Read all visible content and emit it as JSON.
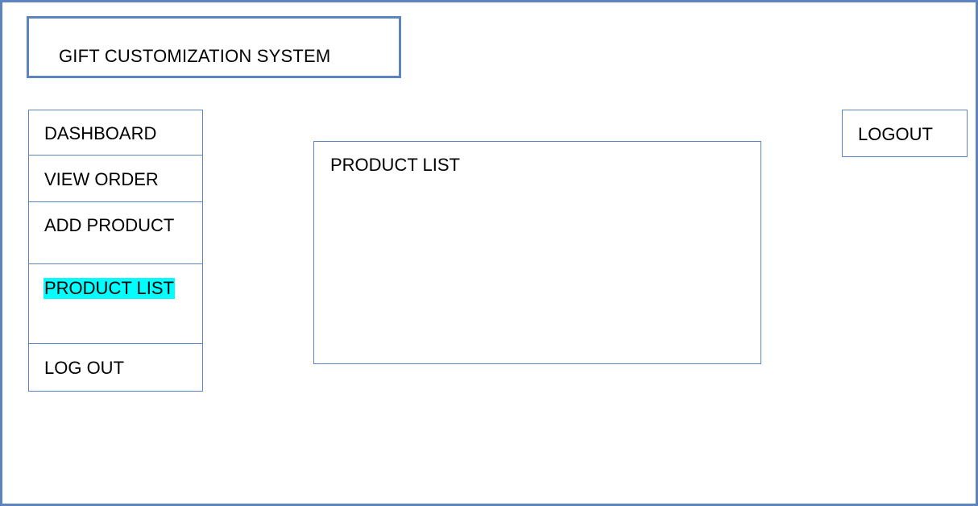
{
  "header": {
    "title": "GIFT CUSTOMIZATION SYSTEM"
  },
  "sidebar": {
    "items": [
      {
        "label": "DASHBOARD",
        "active": false
      },
      {
        "label": "VIEW ORDER",
        "active": false
      },
      {
        "label": "ADD PRODUCT",
        "active": false
      },
      {
        "label": "PRODUCT LIST",
        "active": true
      },
      {
        "label": "LOG OUT",
        "active": false
      }
    ]
  },
  "main": {
    "panel_title": "PRODUCT LIST"
  },
  "topbar": {
    "logout_label": "LOGOUT"
  },
  "colors": {
    "border": "#5b84c0",
    "highlight": "#00ffff",
    "text": "#000000",
    "background": "#ffffff"
  }
}
